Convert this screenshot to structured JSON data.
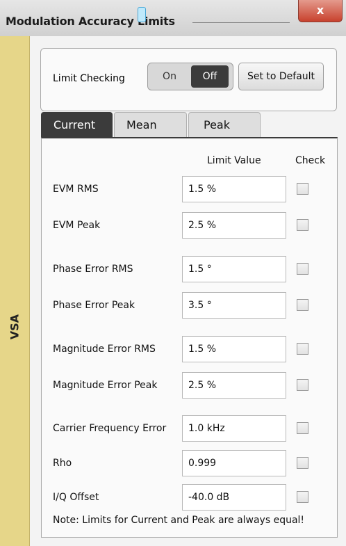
{
  "window": {
    "title": "Modulation Accuracy Limits",
    "close_glyph": "x"
  },
  "sidebar": {
    "label": "VSA"
  },
  "limit_checking": {
    "label": "Limit Checking",
    "on_label": "On",
    "off_label": "Off",
    "selected": "Off",
    "default_button": "Set to Default"
  },
  "tabs": [
    {
      "label": "Current",
      "active": true
    },
    {
      "label": "Mean",
      "active": false
    },
    {
      "label": "Peak",
      "active": false
    }
  ],
  "columns": {
    "limit_value": "Limit Value",
    "check": "Check"
  },
  "rows": [
    {
      "label": "EVM RMS",
      "value": "1.5 %",
      "checked": false
    },
    {
      "label": "EVM Peak",
      "value": "2.5 %",
      "checked": false
    },
    {
      "label": "Phase Error RMS",
      "value": "1.5 °",
      "checked": false
    },
    {
      "label": "Phase Error Peak",
      "value": "3.5 °",
      "checked": false
    },
    {
      "label": "Magnitude Error RMS",
      "value": "1.5 %",
      "checked": false
    },
    {
      "label": "Magnitude Error Peak",
      "value": "2.5 %",
      "checked": false
    },
    {
      "label": "Carrier Frequency Error",
      "value": "1.0 kHz",
      "checked": false
    },
    {
      "label": "Rho",
      "value": "0.999",
      "checked": false
    },
    {
      "label": "I/Q Offset",
      "value": "-40.0 dB",
      "checked": false
    }
  ],
  "note": "Note: Limits for Current and Peak are always equal!",
  "colors": {
    "sidebar": "#e6d689",
    "active_tab": "#3b3b3b",
    "close_button": "#c8412d"
  }
}
